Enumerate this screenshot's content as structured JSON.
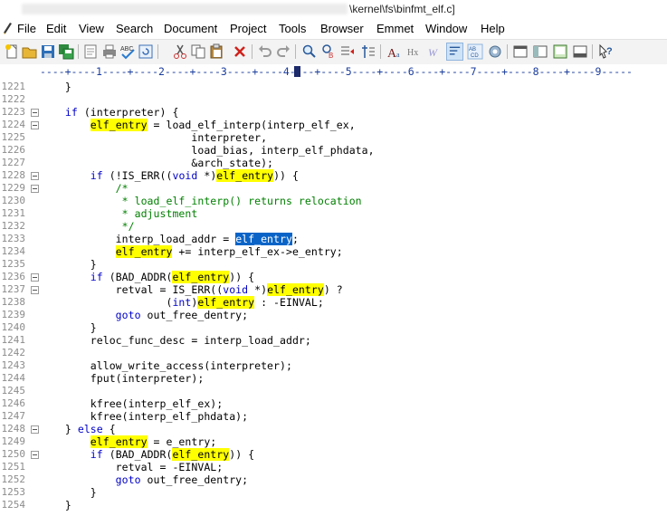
{
  "title": "\\kernel\\fs\\binfmt_elf.c]",
  "menu": [
    "File",
    "Edit",
    "View",
    "Search",
    "Document",
    "Project",
    "Tools",
    "Browser",
    "Emmet",
    "Window",
    "Help"
  ],
  "toolbar_icons": [
    "new-file-icon",
    "open-file-icon",
    "save-icon",
    "save-all-icon",
    "print-preview-icon",
    "print-icon",
    "spell-check-icon",
    "reload-icon",
    "cut-icon",
    "copy-icon",
    "paste-icon",
    "delete-icon",
    "undo-icon",
    "redo-icon",
    "find-icon",
    "replace-icon",
    "goto-icon",
    "font-icon",
    "html-tag-icon",
    "web-icon",
    "word-wrap-icon",
    "column-icon",
    "settings-icon",
    "view1-icon",
    "view2-icon",
    "view3-icon",
    "view4-icon",
    "help-icon"
  ],
  "ruler": "----+----1----+----2----+----3----+----4----+----5----+----6----+----7----+----8----+----9-----",
  "lines": [
    {
      "n": "1221",
      "fold": false,
      "segs": [
        [
          "t",
          "    }"
        ]
      ]
    },
    {
      "n": "1222",
      "fold": false,
      "segs": []
    },
    {
      "n": "1223",
      "fold": true,
      "segs": [
        [
          "k",
          "    if"
        ],
        [
          "t",
          " (interpreter) {"
        ]
      ]
    },
    {
      "n": "1224",
      "fold": true,
      "segs": [
        [
          "t",
          "        "
        ],
        [
          "h",
          "elf_entry"
        ],
        [
          "t",
          " = load_elf_interp(interp_elf_ex,"
        ]
      ]
    },
    {
      "n": "1225",
      "fold": false,
      "segs": [
        [
          "t",
          "                        interpreter,"
        ]
      ]
    },
    {
      "n": "1226",
      "fold": false,
      "segs": [
        [
          "t",
          "                        load_bias, interp_elf_phdata,"
        ]
      ]
    },
    {
      "n": "1227",
      "fold": false,
      "segs": [
        [
          "t",
          "                        &arch_state);"
        ]
      ]
    },
    {
      "n": "1228",
      "fold": true,
      "segs": [
        [
          "k",
          "        if"
        ],
        [
          "t",
          " (!IS_ERR(("
        ],
        [
          "k",
          "void"
        ],
        [
          "t",
          " *)"
        ],
        [
          "h",
          "elf_entry"
        ],
        [
          "t",
          ")) {"
        ]
      ]
    },
    {
      "n": "1229",
      "fold": true,
      "segs": [
        [
          "c",
          "            /*"
        ]
      ]
    },
    {
      "n": "1230",
      "fold": false,
      "segs": [
        [
          "c",
          "             * load_elf_interp() returns relocation"
        ]
      ]
    },
    {
      "n": "1231",
      "fold": false,
      "segs": [
        [
          "c",
          "             * adjustment"
        ]
      ]
    },
    {
      "n": "1232",
      "fold": false,
      "segs": [
        [
          "c",
          "             */"
        ]
      ]
    },
    {
      "n": "1233",
      "fold": false,
      "segs": [
        [
          "t",
          "            interp_load_addr = "
        ],
        [
          "s",
          "elf_entry"
        ],
        [
          "t",
          ";"
        ]
      ]
    },
    {
      "n": "1234",
      "fold": false,
      "segs": [
        [
          "t",
          "            "
        ],
        [
          "h",
          "elf_entry"
        ],
        [
          "t",
          " += interp_elf_ex->e_entry;"
        ]
      ]
    },
    {
      "n": "1235",
      "fold": false,
      "segs": [
        [
          "t",
          "        }"
        ]
      ]
    },
    {
      "n": "1236",
      "fold": true,
      "segs": [
        [
          "k",
          "        if"
        ],
        [
          "t",
          " (BAD_ADDR("
        ],
        [
          "h",
          "elf_entry"
        ],
        [
          "t",
          ")) {"
        ]
      ]
    },
    {
      "n": "1237",
      "fold": true,
      "segs": [
        [
          "t",
          "            retval = IS_ERR(("
        ],
        [
          "k",
          "void"
        ],
        [
          "t",
          " *)"
        ],
        [
          "h",
          "elf_entry"
        ],
        [
          "t",
          ") ?"
        ]
      ]
    },
    {
      "n": "1238",
      "fold": false,
      "segs": [
        [
          "t",
          "                    ("
        ],
        [
          "k",
          "int"
        ],
        [
          "t",
          ")"
        ],
        [
          "h",
          "elf_entry"
        ],
        [
          "t",
          " : -EINVAL;"
        ]
      ]
    },
    {
      "n": "1239",
      "fold": false,
      "segs": [
        [
          "k",
          "            goto"
        ],
        [
          "t",
          " out_free_dentry;"
        ]
      ]
    },
    {
      "n": "1240",
      "fold": false,
      "segs": [
        [
          "t",
          "        }"
        ]
      ]
    },
    {
      "n": "1241",
      "fold": false,
      "segs": [
        [
          "t",
          "        reloc_func_desc = interp_load_addr;"
        ]
      ]
    },
    {
      "n": "1242",
      "fold": false,
      "segs": []
    },
    {
      "n": "1243",
      "fold": false,
      "segs": [
        [
          "t",
          "        allow_write_access(interpreter);"
        ]
      ]
    },
    {
      "n": "1244",
      "fold": false,
      "segs": [
        [
          "t",
          "        fput(interpreter);"
        ]
      ]
    },
    {
      "n": "1245",
      "fold": false,
      "segs": []
    },
    {
      "n": "1246",
      "fold": false,
      "segs": [
        [
          "t",
          "        kfree(interp_elf_ex);"
        ]
      ]
    },
    {
      "n": "1247",
      "fold": false,
      "segs": [
        [
          "t",
          "        kfree(interp_elf_phdata);"
        ]
      ]
    },
    {
      "n": "1248",
      "fold": true,
      "segs": [
        [
          "t",
          "    } "
        ],
        [
          "k",
          "else"
        ],
        [
          "t",
          " {"
        ]
      ]
    },
    {
      "n": "1249",
      "fold": false,
      "segs": [
        [
          "t",
          "        "
        ],
        [
          "h",
          "elf_entry"
        ],
        [
          "t",
          " = e_entry;"
        ]
      ]
    },
    {
      "n": "1250",
      "fold": true,
      "segs": [
        [
          "k",
          "        if"
        ],
        [
          "t",
          " (BAD_ADDR("
        ],
        [
          "h",
          "elf_entry"
        ],
        [
          "t",
          ")) {"
        ]
      ]
    },
    {
      "n": "1251",
      "fold": false,
      "segs": [
        [
          "t",
          "            retval = -EINVAL;"
        ]
      ]
    },
    {
      "n": "1252",
      "fold": false,
      "segs": [
        [
          "k",
          "            goto"
        ],
        [
          "t",
          " out_free_dentry;"
        ]
      ]
    },
    {
      "n": "1253",
      "fold": false,
      "segs": [
        [
          "t",
          "        }"
        ]
      ]
    },
    {
      "n": "1254",
      "fold": false,
      "segs": [
        [
          "t",
          "    }"
        ]
      ]
    }
  ]
}
